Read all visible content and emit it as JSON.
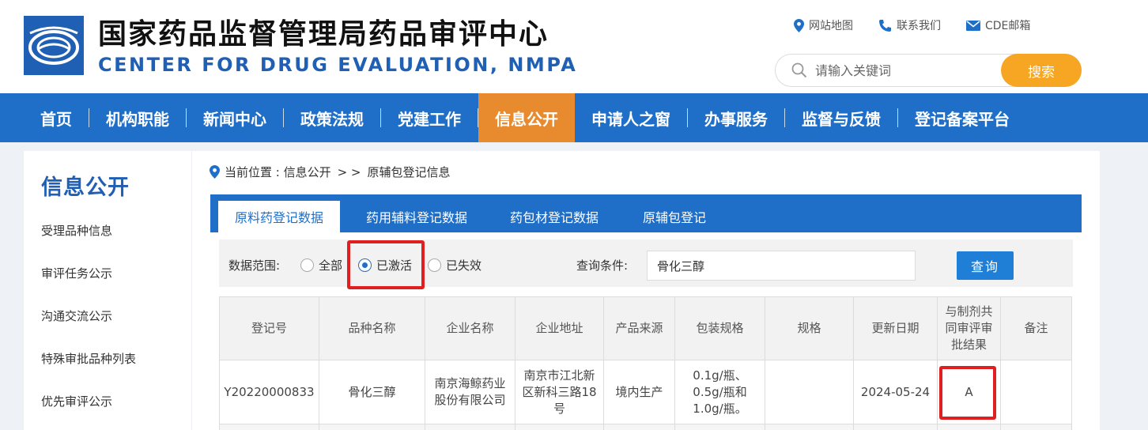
{
  "header": {
    "title_cn": "国家药品监督管理局药品审评中心",
    "title_en": "CENTER FOR DRUG EVALUATION, NMPA",
    "links": [
      {
        "label": "网站地图",
        "icon": "map-pin-icon"
      },
      {
        "label": "联系我们",
        "icon": "phone-icon"
      },
      {
        "label": "CDE邮箱",
        "icon": "mail-icon"
      }
    ],
    "search": {
      "placeholder": "请输入关键词",
      "button": "搜索"
    }
  },
  "nav": {
    "items": [
      "首页",
      "机构职能",
      "新闻中心",
      "政策法规",
      "党建工作",
      "信息公开",
      "申请人之窗",
      "办事服务",
      "监督与反馈",
      "登记备案平台"
    ],
    "active": "信息公开"
  },
  "sidebar": {
    "title": "信息公开",
    "items": [
      "受理品种信息",
      "审评任务公示",
      "沟通交流公示",
      "特殊审批品种列表",
      "优先审评公示"
    ]
  },
  "breadcrumb": {
    "prefix": "当前位置 : 信息公开",
    "sep": "> >",
    "current": "原辅包登记信息"
  },
  "tabs": [
    "原料药登记数据",
    "药用辅料登记数据",
    "药包材登记数据",
    "原辅包登记"
  ],
  "filter": {
    "range_label": "数据范围:",
    "options": [
      "全部",
      "已激活",
      "已失效"
    ],
    "selected": "已激活",
    "query_label": "查询条件:",
    "query_value": "骨化三醇",
    "query_button": "查询"
  },
  "table": {
    "columns": [
      "登记号",
      "品种名称",
      "企业名称",
      "企业地址",
      "产品来源",
      "包装规格",
      "规格",
      "更新日期",
      "与制剂共同审评审批结果",
      "备注"
    ],
    "rows": [
      [
        "Y20220000833",
        "骨化三醇",
        "南京海鲸药业股份有限公司",
        "南京市江北新区新科三路18号",
        "境内生产",
        "0.1g/瓶、0.5g/瓶和1.0g/瓶。",
        "",
        "2024-05-24",
        "A",
        ""
      ]
    ]
  },
  "colors": {
    "primary": "#1f6fc9",
    "accent": "#e88b2e",
    "search_button": "#f6a623",
    "highlight": "#e02020"
  }
}
